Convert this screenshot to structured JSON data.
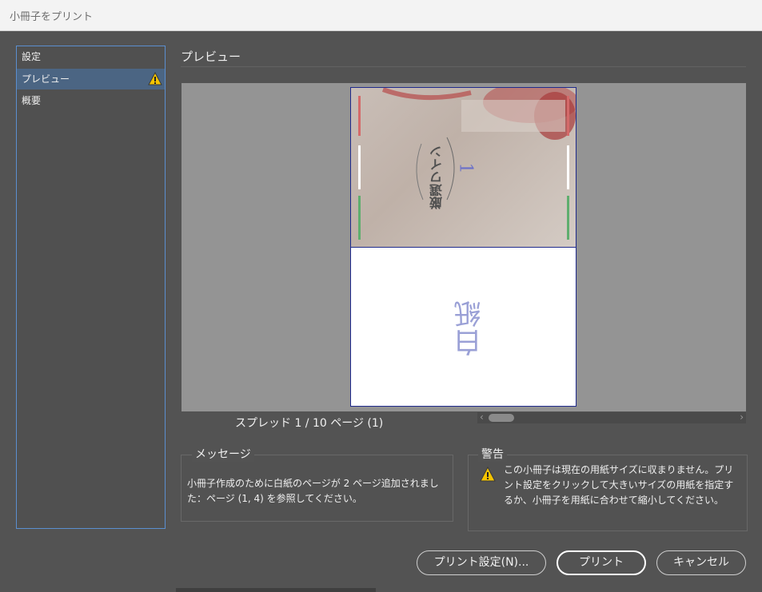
{
  "window": {
    "title": "小冊子をプリント"
  },
  "sidebar": {
    "items": [
      {
        "label": "設定"
      },
      {
        "label": "プレビュー",
        "warning": true
      },
      {
        "label": "概要"
      }
    ]
  },
  "preview": {
    "title": "プレビュー",
    "blank_page_label": "白紙",
    "cover_title": "厳選ワイン",
    "cover_number": "1",
    "spread_text": "スプレッド 1 / 10 ページ (1)"
  },
  "messages": {
    "title": "メッセージ",
    "text": "小冊子作成のために白紙のページが 2 ページ追加されました：ページ (1, 4) を参照してください。"
  },
  "warning": {
    "title": "警告",
    "text": "この小冊子は現在の用紙サイズに収まりません。プリント設定をクリックして大きいサイズの用紙を指定するか、小冊子を用紙に合わせて縮小してください。"
  },
  "buttons": {
    "print_settings": "プリント設定(N)...",
    "print": "プリント",
    "cancel": "キャンセル"
  },
  "colors": {
    "background": "#535353",
    "selection": "#4b6583",
    "focus_border": "#5b8fd0",
    "warning_icon": "#f5c400"
  }
}
